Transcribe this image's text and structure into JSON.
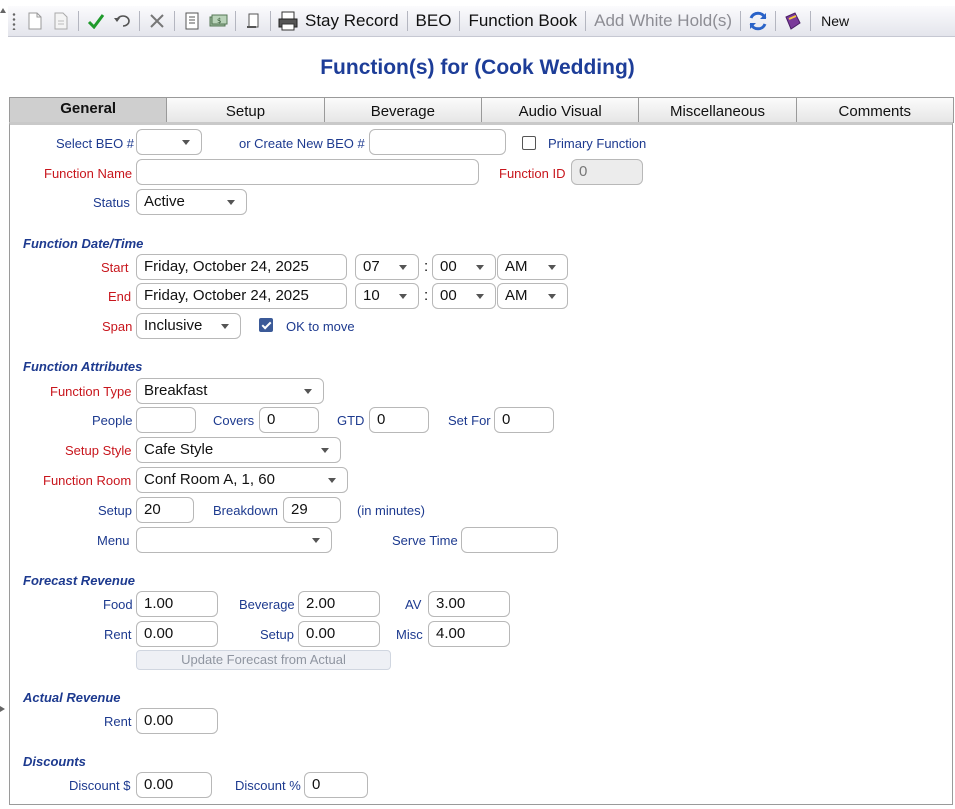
{
  "toolbar": {
    "stay_record": "Stay Record",
    "beo": "BEO",
    "function_book": "Function Book",
    "add_white_hold": "Add White Hold(s)",
    "new": "New"
  },
  "page_title": "Function(s) for (Cook Wedding)",
  "tabs": [
    "General",
    "Setup",
    "Beverage",
    "Audio Visual",
    "Miscellaneous",
    "Comments"
  ],
  "general": {
    "select_beo_label": "Select BEO #",
    "select_beo_value": "",
    "create_beo_label": "or Create New BEO #",
    "create_beo_value": "",
    "primary_function_label": "Primary Function",
    "function_name_label": "Function Name",
    "function_name_value": "",
    "function_id_label": "Function ID",
    "function_id_value": "0",
    "status_label": "Status",
    "status_value": "Active"
  },
  "datetime": {
    "heading": "Function Date/Time",
    "start_label": "Start",
    "start_date": "Friday, October 24, 2025",
    "start_hour": "07",
    "start_min": "00",
    "start_ampm": "AM",
    "end_label": "End",
    "end_date": "Friday, October 24, 2025",
    "end_hour": "10",
    "end_min": "00",
    "end_ampm": "AM",
    "span_label": "Span",
    "span_value": "Inclusive",
    "ok_to_move_label": "OK to move",
    "colon": ":"
  },
  "attributes": {
    "heading": "Function Attributes",
    "function_type_label": "Function Type",
    "function_type_value": "Breakfast",
    "people_label": "People",
    "people_value": "",
    "covers_label": "Covers",
    "covers_value": "0",
    "gtd_label": "GTD",
    "gtd_value": "0",
    "set_for_label": "Set For",
    "set_for_value": "0",
    "setup_style_label": "Setup Style",
    "setup_style_value": "Cafe Style",
    "function_room_label": "Function Room",
    "function_room_value": "Conf Room A, 1, 60",
    "setup_label": "Setup",
    "setup_value": "20",
    "breakdown_label": "Breakdown",
    "breakdown_value": "29",
    "minutes_note": "(in minutes)",
    "menu_label": "Menu",
    "menu_value": "",
    "serve_time_label": "Serve Time",
    "serve_time_value": ""
  },
  "forecast": {
    "heading": "Forecast Revenue",
    "food_label": "Food",
    "food_value": "1.00",
    "beverage_label": "Beverage",
    "beverage_value": "2.00",
    "av_label": "AV",
    "av_value": "3.00",
    "rent_label": "Rent",
    "rent_value": "0.00",
    "setup_label": "Setup",
    "setup_value": "0.00",
    "misc_label": "Misc",
    "misc_value": "4.00",
    "update_button": "Update Forecast from Actual"
  },
  "actual": {
    "heading": "Actual Revenue",
    "rent_label": "Rent",
    "rent_value": "0.00"
  },
  "discounts": {
    "heading": "Discounts",
    "discount_amount_label": "Discount $",
    "discount_amount_value": "0.00",
    "discount_pct_label": "Discount %",
    "discount_pct_value": "0"
  },
  "colors": {
    "label_blue": "#1d3a8f",
    "required_red": "#c8161d",
    "title_blue": "#1d3d98"
  }
}
